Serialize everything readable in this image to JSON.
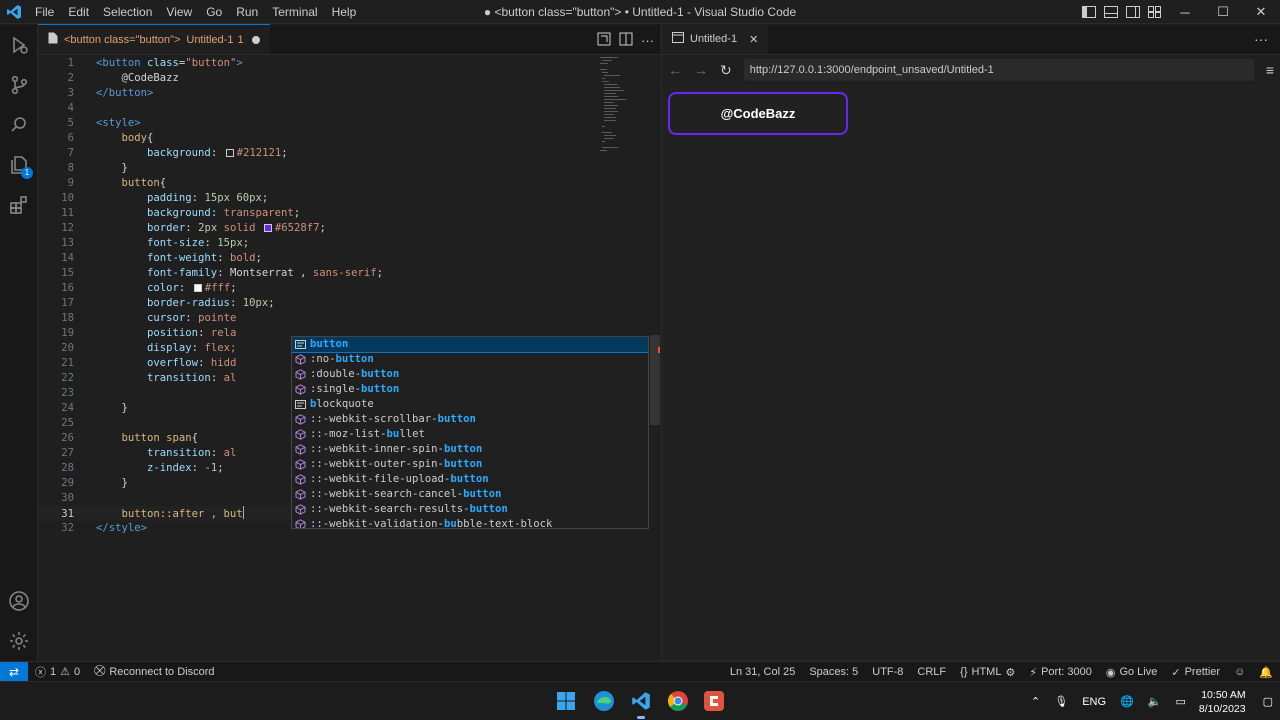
{
  "window": {
    "title": "● <button class=\"button\"> • Untitled-1 - Visual Studio Code",
    "menu": [
      "File",
      "Edit",
      "Selection",
      "View",
      "Go",
      "Run",
      "Terminal",
      "Help"
    ]
  },
  "activity_bar": {
    "items": [
      "run-debug",
      "source-control",
      "search",
      "explorer",
      "extensions"
    ],
    "explorer_badge": "1",
    "bottom": [
      "accounts",
      "manage"
    ]
  },
  "editor": {
    "tab": {
      "name": "<button class=\"button\">",
      "file": "Untitled-1",
      "problems": "1"
    },
    "lines": [
      {
        "n": "1",
        "segments": [
          [
            "tag",
            "<button "
          ],
          [
            "attr",
            "class"
          ],
          [
            "txt",
            "="
          ],
          [
            "str",
            "\"button\""
          ],
          [
            "tag",
            ">"
          ]
        ]
      },
      {
        "n": "2",
        "segments": [
          [
            "txt",
            "    @CodeBazz"
          ]
        ]
      },
      {
        "n": "3",
        "segments": [
          [
            "tag",
            "</button>"
          ]
        ]
      },
      {
        "n": "4",
        "segments": []
      },
      {
        "n": "5",
        "segments": [
          [
            "tag",
            "<style>"
          ]
        ]
      },
      {
        "n": "6",
        "segments": [
          [
            "sel",
            "    body"
          ],
          [
            "txt",
            "{"
          ]
        ]
      },
      {
        "n": "7",
        "segments": [
          [
            "prop",
            "        background"
          ],
          [
            "txt",
            ": "
          ],
          [
            "swatch",
            "#212121"
          ],
          [
            "val",
            "#212121"
          ],
          [
            "txt",
            ";"
          ]
        ]
      },
      {
        "n": "8",
        "segments": [
          [
            "txt",
            "    }"
          ]
        ]
      },
      {
        "n": "9",
        "segments": [
          [
            "sel",
            "    button"
          ],
          [
            "txt",
            "{"
          ]
        ]
      },
      {
        "n": "10",
        "segments": [
          [
            "prop",
            "        padding"
          ],
          [
            "txt",
            ": "
          ],
          [
            "num",
            "15px 60px"
          ],
          [
            "txt",
            ";"
          ]
        ]
      },
      {
        "n": "11",
        "segments": [
          [
            "prop",
            "        background"
          ],
          [
            "txt",
            ": "
          ],
          [
            "val",
            "transparent"
          ],
          [
            "txt",
            ";"
          ]
        ]
      },
      {
        "n": "12",
        "segments": [
          [
            "prop",
            "        border"
          ],
          [
            "txt",
            ": "
          ],
          [
            "num",
            "2px "
          ],
          [
            "val",
            "solid "
          ],
          [
            "swatch",
            "#6528f7"
          ],
          [
            "val",
            "#6528f7"
          ],
          [
            "txt",
            ";"
          ]
        ]
      },
      {
        "n": "13",
        "segments": [
          [
            "prop",
            "        font-size"
          ],
          [
            "txt",
            ": "
          ],
          [
            "num",
            "15px"
          ],
          [
            "txt",
            ";"
          ]
        ]
      },
      {
        "n": "14",
        "segments": [
          [
            "prop",
            "        font-weight"
          ],
          [
            "txt",
            ": "
          ],
          [
            "val",
            "bold"
          ],
          [
            "txt",
            ";"
          ]
        ]
      },
      {
        "n": "15",
        "segments": [
          [
            "prop",
            "        font-family"
          ],
          [
            "txt",
            ": Montserrat , "
          ],
          [
            "val",
            "sans-serif"
          ],
          [
            "txt",
            ";"
          ]
        ]
      },
      {
        "n": "16",
        "segments": [
          [
            "prop",
            "        color"
          ],
          [
            "txt",
            ": "
          ],
          [
            "swatch",
            "#ffffff"
          ],
          [
            "val",
            "#fff"
          ],
          [
            "txt",
            ";"
          ]
        ]
      },
      {
        "n": "17",
        "segments": [
          [
            "prop",
            "        border-radius"
          ],
          [
            "txt",
            ": "
          ],
          [
            "num",
            "10px"
          ],
          [
            "txt",
            ";"
          ]
        ]
      },
      {
        "n": "18",
        "segments": [
          [
            "prop",
            "        cursor"
          ],
          [
            "txt",
            ": "
          ],
          [
            "val",
            "pointe"
          ]
        ]
      },
      {
        "n": "19",
        "segments": [
          [
            "prop",
            "        position"
          ],
          [
            "txt",
            ": "
          ],
          [
            "val",
            "rela"
          ]
        ]
      },
      {
        "n": "20",
        "segments": [
          [
            "prop",
            "        display"
          ],
          [
            "txt",
            ": "
          ],
          [
            "val",
            "flex;"
          ]
        ]
      },
      {
        "n": "21",
        "segments": [
          [
            "prop",
            "        overflow"
          ],
          [
            "txt",
            ": "
          ],
          [
            "val",
            "hidd"
          ]
        ]
      },
      {
        "n": "22",
        "segments": [
          [
            "prop",
            "        transition"
          ],
          [
            "txt",
            ": "
          ],
          [
            "val",
            "al"
          ]
        ]
      },
      {
        "n": "23",
        "segments": []
      },
      {
        "n": "24",
        "segments": [
          [
            "txt",
            "    }"
          ]
        ]
      },
      {
        "n": "25",
        "segments": []
      },
      {
        "n": "26",
        "segments": [
          [
            "sel",
            "    button span"
          ],
          [
            "txt",
            "{"
          ]
        ]
      },
      {
        "n": "27",
        "segments": [
          [
            "prop",
            "        transition"
          ],
          [
            "txt",
            ": "
          ],
          [
            "val",
            "al"
          ]
        ]
      },
      {
        "n": "28",
        "segments": [
          [
            "prop",
            "        z-index"
          ],
          [
            "txt",
            ": "
          ],
          [
            "num",
            "-1"
          ],
          [
            "txt",
            ";"
          ]
        ]
      },
      {
        "n": "29",
        "segments": [
          [
            "txt",
            "    }"
          ]
        ]
      },
      {
        "n": "30",
        "segments": []
      },
      {
        "n": "31",
        "segments": [
          [
            "sel",
            "    button::after , but"
          ]
        ]
      },
      {
        "n": "32",
        "segments": [
          [
            "tag",
            "</style>"
          ]
        ]
      }
    ],
    "active_line": "31",
    "suggestions": [
      {
        "icon": "tag",
        "pre": "",
        "hl": "button",
        "post": ""
      },
      {
        "icon": "pseudo",
        "pre": ":no-",
        "hl": "button",
        "post": ""
      },
      {
        "icon": "pseudo",
        "pre": ":double-",
        "hl": "button",
        "post": ""
      },
      {
        "icon": "pseudo",
        "pre": ":single-",
        "hl": "button",
        "post": ""
      },
      {
        "icon": "tag",
        "pre": "",
        "hl": "b",
        "post": "lockquote"
      },
      {
        "icon": "pseudo",
        "pre": "::-webkit-scrollbar-",
        "hl": "button",
        "post": ""
      },
      {
        "icon": "pseudo",
        "pre": "::-moz-list-",
        "hl": "bu",
        "post": "llet"
      },
      {
        "icon": "pseudo",
        "pre": "::-webkit-inner-spin-",
        "hl": "button",
        "post": ""
      },
      {
        "icon": "pseudo",
        "pre": "::-webkit-outer-spin-",
        "hl": "button",
        "post": ""
      },
      {
        "icon": "pseudo",
        "pre": "::-webkit-file-upload-",
        "hl": "button",
        "post": ""
      },
      {
        "icon": "pseudo",
        "pre": "::-webkit-search-cancel-",
        "hl": "button",
        "post": ""
      },
      {
        "icon": "pseudo",
        "pre": "::-webkit-search-results-",
        "hl": "button",
        "post": ""
      },
      {
        "icon": "pseudo",
        "pre": "::-webkit-validation-",
        "hl": "bu",
        "post": "bble-text-block"
      }
    ]
  },
  "preview": {
    "tab": "Untitled-1",
    "url": "http://127.0.0.1:3000/endpoint_unsaved/Untitled-1",
    "button_text": "@CodeBazz"
  },
  "status": {
    "remote_icon": "remote-icon",
    "errors": "1",
    "warnings": "0",
    "discord": "Reconnect to Discord",
    "position": "Ln 31, Col 25",
    "spaces": "Spaces: 5",
    "encoding": "UTF-8",
    "eol": "CRLF",
    "language": "HTML",
    "port": "Port: 3000",
    "golive": "Go Live",
    "prettier": "Prettier"
  },
  "taskbar": {
    "apps": [
      "windows-start",
      "edge",
      "vscode",
      "chrome",
      "app-red"
    ],
    "lang": "ENG",
    "time": "10:50 AM",
    "date": "8/10/2023"
  },
  "colors": {
    "accent": "#0078d4",
    "purple": "#6528f7",
    "preview_bg": "#212121"
  }
}
